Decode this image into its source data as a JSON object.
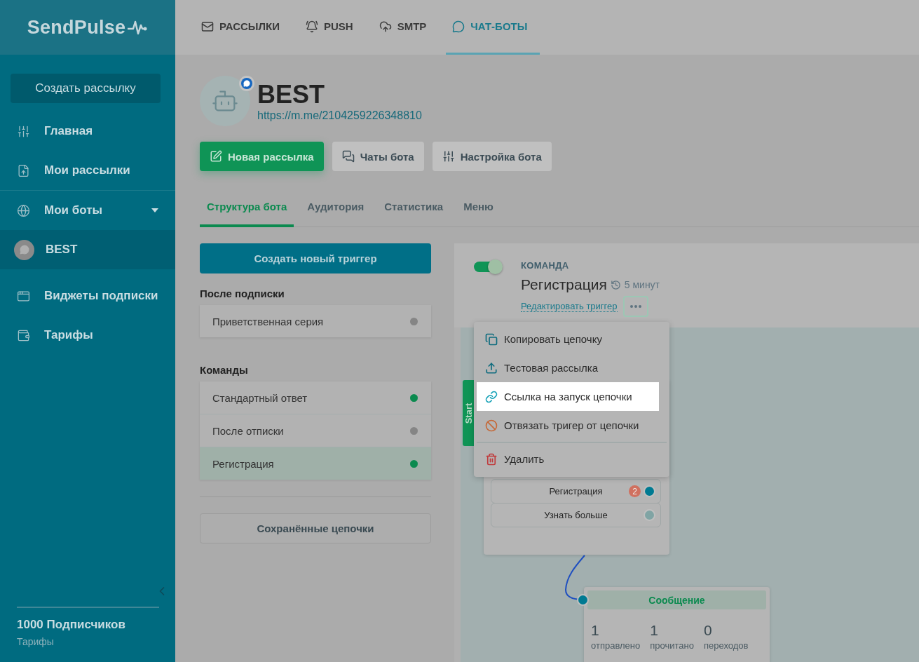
{
  "logo": "SendPulse",
  "top_nav": [
    {
      "label": "РАССЫЛКИ",
      "selected": false
    },
    {
      "label": "PUSH",
      "selected": false
    },
    {
      "label": "SMTP",
      "selected": false
    },
    {
      "label": "ЧАТ-БОТЫ",
      "selected": true
    }
  ],
  "sidebar": {
    "create_button": "Создать рассылку",
    "items": [
      {
        "label": "Главная",
        "selected": false,
        "divider_after": false
      },
      {
        "label": "Мои рассылки",
        "selected": false,
        "divider_after": true
      },
      {
        "label": "Мои боты",
        "selected": false,
        "divider_after": false,
        "dropdown": true
      },
      {
        "label": "BEST",
        "selected": true,
        "divider_after": false
      },
      {
        "label": "Виджеты подписки",
        "selected": false,
        "divider_after": false
      },
      {
        "label": "Тарифы",
        "selected": false,
        "divider_after": false
      }
    ],
    "subscribers": "1000 Подписчиков",
    "plan_link": "Тарифы"
  },
  "bot": {
    "name": "BEST",
    "link": "https://m.me/2104259226348810"
  },
  "actions": [
    {
      "label": "Новая рассылка",
      "kind": "primary"
    },
    {
      "label": "Чаты бота",
      "kind": "secondary"
    },
    {
      "label": "Настройка бота",
      "kind": "secondary"
    }
  ],
  "tabs": [
    {
      "label": "Структура бота",
      "selected": true
    },
    {
      "label": "Аудитория",
      "selected": false
    },
    {
      "label": "Статистика",
      "selected": false
    },
    {
      "label": "Меню",
      "selected": false
    }
  ],
  "triggers": {
    "create_button": "Создать новый триггер",
    "groups": [
      {
        "title": "После подписки",
        "items": [
          {
            "label": "Приветственная серия",
            "active": false,
            "selected": false
          }
        ]
      },
      {
        "title": "Команды",
        "items": [
          {
            "label": "Стандартный ответ",
            "active": true,
            "selected": false
          },
          {
            "label": "После отписки",
            "active": false,
            "selected": false
          },
          {
            "label": "Регистрация",
            "active": true,
            "selected": true
          }
        ]
      }
    ],
    "saved_button": "Сохранённые цепочки"
  },
  "trigger_detail": {
    "enabled": true,
    "type": "КОМАНДА",
    "name": "Регистрация",
    "delay": "5 минут",
    "edit_link": "Редактировать триггер"
  },
  "menu": [
    {
      "label": "Копировать цепочку",
      "selected": false
    },
    {
      "label": "Тестовая рассылка",
      "selected": false
    },
    {
      "label": "Ссылка на запуск цепочки",
      "selected": true
    },
    {
      "label": "Отвязать тригер от цепочки",
      "selected": false
    },
    {
      "label": "Удалить",
      "selected": false
    }
  ],
  "flow": {
    "start_label": "Start",
    "buttons": [
      {
        "label": "Регистрация",
        "badge": "2",
        "connected": true
      },
      {
        "label": "Узнать больше",
        "connected": false
      }
    ],
    "message": {
      "title": "Сообщение",
      "stats": [
        {
          "value": "1",
          "label": "отправлено"
        },
        {
          "value": "1",
          "label": "прочитано"
        },
        {
          "value": "0",
          "label": "переходов"
        }
      ]
    }
  }
}
